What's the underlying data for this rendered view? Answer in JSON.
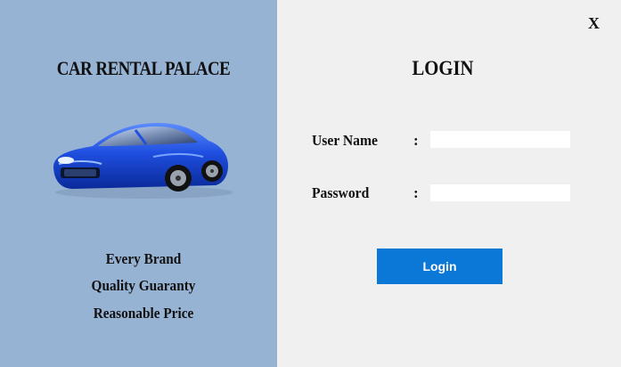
{
  "app": {
    "brand_title": "CAR RENTAL PALACE",
    "close_label": "X"
  },
  "features": [
    "Every Brand",
    "Quality Guaranty",
    "Reasonable Price"
  ],
  "login": {
    "title": "LOGIN",
    "username_label": "User Name",
    "password_label": "Password",
    "colon": ":",
    "username_value": "",
    "password_value": "",
    "button_label": "Login"
  },
  "colors": {
    "left_panel": "#97b3d4",
    "right_panel": "#f0f0f0",
    "button": "#0b78d7",
    "car_body": "#1f4fe0"
  },
  "icons": {
    "car": "car-icon"
  }
}
